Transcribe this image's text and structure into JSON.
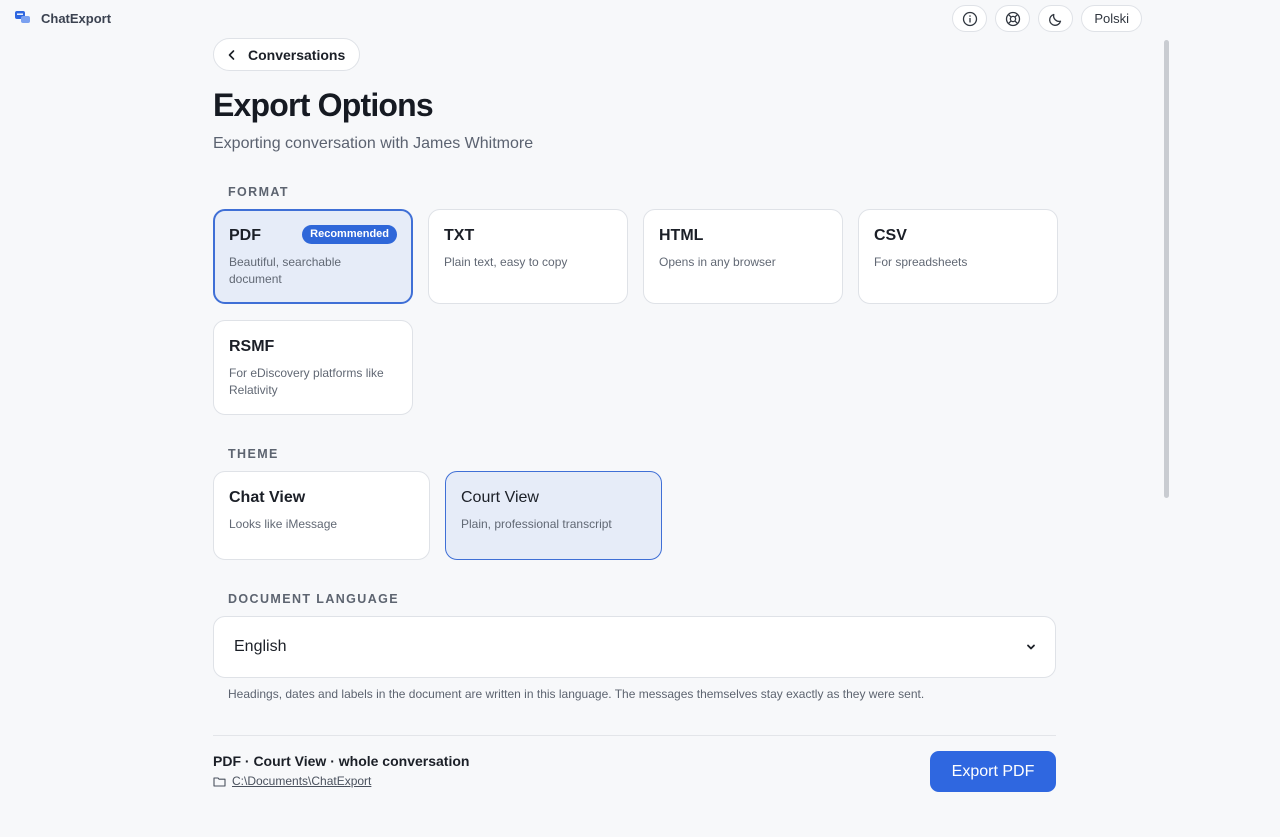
{
  "app": {
    "title": "ChatExport",
    "brand_color": "#2f67e0"
  },
  "top_actions": {
    "icons": [
      "info-icon",
      "help-icon",
      "moon-icon"
    ],
    "language_label": "Polski"
  },
  "nav": {
    "back_label": "Conversations"
  },
  "page": {
    "title": "Export Options",
    "subtitle": "Exporting conversation with James Whitmore"
  },
  "format": {
    "label": "FORMAT",
    "options": [
      {
        "title": "PDF",
        "desc": "Beautiful, searchable document",
        "badge": "Recommended",
        "selected": true
      },
      {
        "title": "TXT",
        "desc": "Plain text, easy to copy"
      },
      {
        "title": "HTML",
        "desc": "Opens in any browser"
      },
      {
        "title": "CSV",
        "desc": "For spreadsheets"
      },
      {
        "title": "RSMF",
        "desc": "For eDiscovery platforms like Relativity"
      }
    ]
  },
  "theme": {
    "label": "THEME",
    "options": [
      {
        "title": "Chat View",
        "desc": "Looks like iMessage"
      },
      {
        "title": "Court View",
        "desc": "Plain, professional transcript",
        "selected": true
      }
    ]
  },
  "language": {
    "label": "DOCUMENT LANGUAGE",
    "value": "English",
    "help": "Headings, dates and labels in the document are written in this language. The messages themselves stay exactly as they were sent."
  },
  "footer": {
    "summary": "PDF · Court View · whole conversation",
    "path": "C:\\Documents\\ChatExport",
    "export_label": "Export PDF"
  }
}
